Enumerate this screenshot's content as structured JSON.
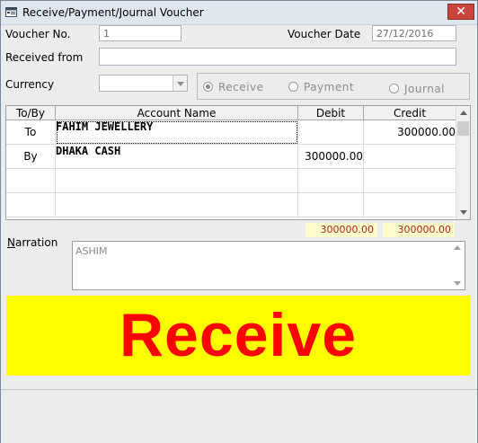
{
  "window": {
    "title": "Receive/Payment/Journal Voucher",
    "close_label": "✕"
  },
  "form": {
    "voucher_no_label": "Voucher No.",
    "voucher_no_value": "1",
    "voucher_date_label": "Voucher Date",
    "voucher_date_value": "27/12/2016",
    "received_from_label": "Received from",
    "received_from_value": "",
    "currency_label": "Currency",
    "currency_value": ""
  },
  "voucher_type": {
    "options": [
      {
        "label": "Receive",
        "selected": true
      },
      {
        "label": "Payment",
        "selected": false
      },
      {
        "label": "Journal",
        "selected": false
      }
    ]
  },
  "grid": {
    "headers": [
      "To/By",
      "Account Name",
      "Debit",
      "Credit"
    ],
    "rows": [
      {
        "toby": "To",
        "account": "FAHIM JEWELLERY",
        "debit": "",
        "credit": "300000.00"
      },
      {
        "toby": "By",
        "account": "DHAKA CASH",
        "debit": "300000.00",
        "credit": ""
      },
      {
        "toby": "",
        "account": "",
        "debit": "",
        "credit": ""
      },
      {
        "toby": "",
        "account": "",
        "debit": "",
        "credit": ""
      }
    ]
  },
  "totals": {
    "debit": "300000.00",
    "credit": "300000.00"
  },
  "narration": {
    "label": "Narration",
    "value": "ASHIM"
  },
  "banner": {
    "text": "Receive",
    "background": "#ffff00",
    "color": "#ff0000"
  }
}
